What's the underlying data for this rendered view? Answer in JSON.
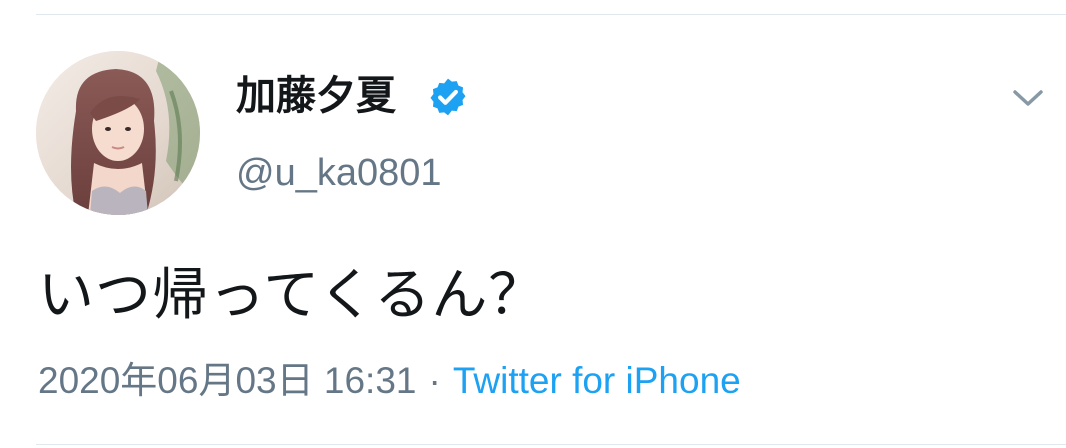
{
  "tweet": {
    "author": {
      "display_name": "加藤夕夏",
      "handle": "@u_ka0801",
      "verified": true,
      "verified_icon": "verified-badge-icon",
      "avatar": "profile-photo"
    },
    "text": "いつ帰ってくるん？",
    "timestamp": "2020年06月03日 16:31",
    "separator": "·",
    "source": "Twitter for iPhone",
    "menu_icon": "chevron-down-icon"
  },
  "colors": {
    "text_primary": "#14171a",
    "text_secondary": "#657786",
    "accent": "#1da1f2",
    "divider": "#e1e8ed"
  }
}
